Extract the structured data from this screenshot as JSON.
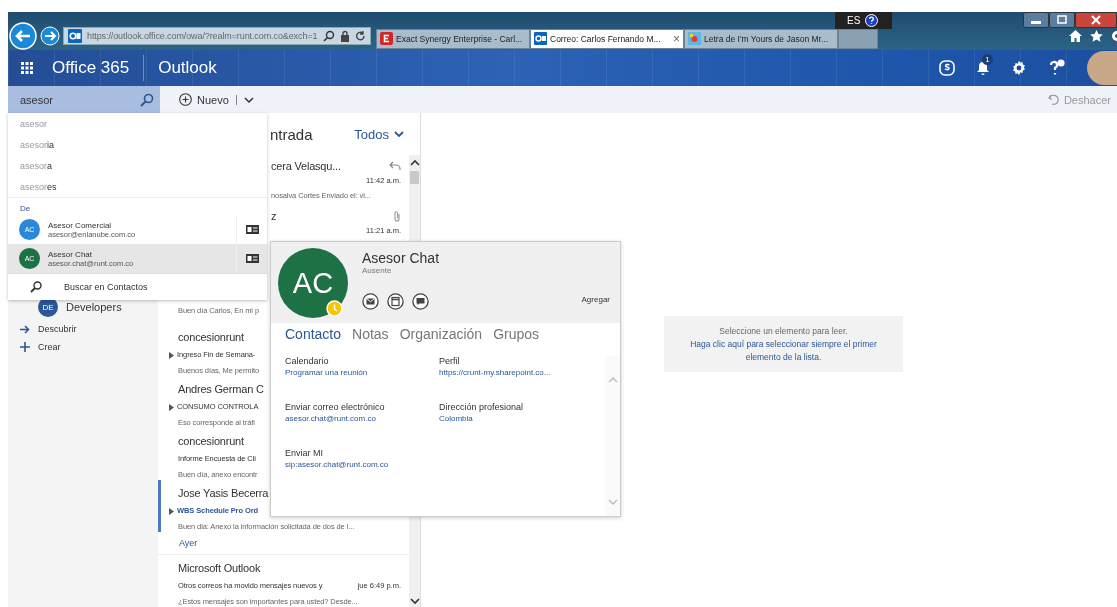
{
  "browser": {
    "address": "https://outlook.office.com/owa/?realm=runt.com.co&exch=1",
    "language": "ES",
    "tabs": [
      {
        "label": "Exact Synergy Enterprise - Carl...",
        "selected": false
      },
      {
        "label": "Correo: Carlos Fernando M...",
        "selected": true,
        "close": "×"
      },
      {
        "label": "Letra de I'm Yours de Jason Mr...",
        "selected": false
      }
    ]
  },
  "header": {
    "suite": "Office 365",
    "app": "Outlook",
    "notification_count": "1"
  },
  "command_bar": {
    "search": {
      "value": "asesor"
    },
    "new_button": "Nuevo",
    "undo_button": "Deshacer"
  },
  "search_dropdown": {
    "suggestions": [
      {
        "typed": "asesor"
      },
      {
        "typed": "asesor",
        "completion": "ia"
      },
      {
        "typed": "asesor",
        "completion": "a"
      },
      {
        "typed": "asesor",
        "completion": "es"
      }
    ],
    "section": "De",
    "contacts": [
      {
        "initials": "AC",
        "name": "Asesor Comercial",
        "email": "asesor@enlanube.com.co",
        "color": "#2b88d8",
        "selected": false
      },
      {
        "initials": "AC",
        "name": "Asesor Chat",
        "email": "asesor.chat@runt.com.co",
        "color": "#1e7145",
        "selected": true
      }
    ],
    "search_contacts": "Buscar en Contactos"
  },
  "nav": {
    "items": [
      {
        "kind": "group",
        "initials": "DE",
        "label": "Developers"
      },
      {
        "kind": "discover",
        "label": "Descubrir"
      },
      {
        "kind": "create",
        "label": "Crear"
      }
    ]
  },
  "mail_list": {
    "folder_title": "ntrada",
    "filter": "Todos",
    "items": [
      {
        "kind": "message",
        "sender": "cera Velasqu...",
        "time": "11:42 a.m.",
        "preview": "nosalva Cortes Enviado el: vi..."
      },
      {
        "kind": "message",
        "sender": "z",
        "time": "11:21 a.m."
      },
      {
        "kind": "message",
        "preview": "Buen día Carlos, En mi p"
      },
      {
        "kind": "message",
        "sender": "concesionrunt",
        "subject": "Ingreso Fin de Semana-",
        "preview": "Buenos días, Me permito",
        "expandable": true,
        "unread": false
      },
      {
        "kind": "message",
        "sender": "Andres German C",
        "subject": "CONSUMO CONTROLA",
        "preview": "Eso corresponde al tráfi",
        "expandable": true,
        "unread": false
      },
      {
        "kind": "message",
        "sender": "concesionrunt",
        "subject": "Informe Encuesta de Cli",
        "preview": "Buen día, anexo encontr",
        "expandable": false,
        "unread": false
      },
      {
        "kind": "message",
        "sender": "Jose Yasis Becerra",
        "subject": "WBS Schedule Pro Ord",
        "preview": "Buen dia: Anexo la información solicitada de dos de l...",
        "expandable": true,
        "unread": true
      },
      {
        "kind": "date_header",
        "label": "Ayer"
      },
      {
        "kind": "message",
        "sender": "Microsoft Outlook",
        "subject": "Otros correos ha movido mensajes nuevos y",
        "time": "jue 6:49 p.m.",
        "preview": "¿Estos mensajes son importantes para usted? Desde...",
        "expandable": false,
        "unread": false
      }
    ]
  },
  "contact_card": {
    "initials": "AC",
    "color": "#1e7145",
    "name": "Asesor Chat",
    "status": "Ausente",
    "add_button": "Agregar",
    "tabs": [
      {
        "label": "Contacto",
        "selected": true
      },
      {
        "label": "Notas",
        "selected": false
      },
      {
        "label": "Organización",
        "selected": false
      },
      {
        "label": "Grupos",
        "selected": false
      }
    ],
    "fields": [
      {
        "label": "Calendario",
        "value": "Programar una reunión"
      },
      {
        "label": "Perfil",
        "value": "https://crunt-my.sharepoint.co..."
      },
      {
        "label": "Enviar correo electrónico",
        "value": "asesor.chat@runt.com.co"
      },
      {
        "label": "Dirección profesional",
        "value": "Colombia"
      },
      {
        "label": "Enviar MI",
        "value": "sip:asesor.chat@runt.com.co"
      }
    ]
  },
  "reading_pane": {
    "message": "Seleccione un elemento para leer.",
    "link": "Haga clic aquí para seleccionar siempre el primer elemento de la lista."
  }
}
